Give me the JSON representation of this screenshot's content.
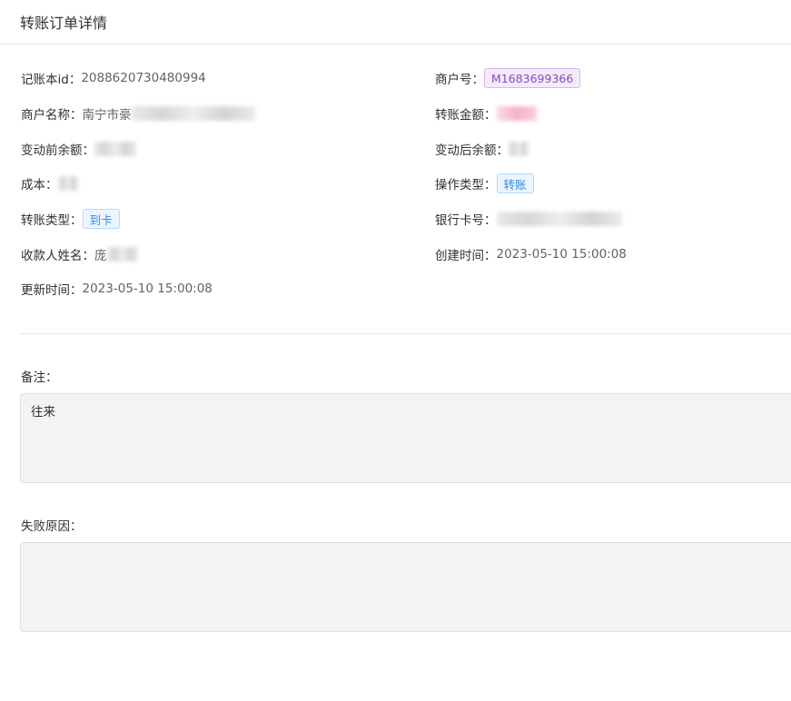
{
  "header": {
    "title": "转账订单详情"
  },
  "fields": {
    "ledger_id": {
      "label": "记账本id：",
      "value": "2088620730480994"
    },
    "merchant_no": {
      "label": "商户号：",
      "value": "M1683699366"
    },
    "merchant_name": {
      "label": "商户名称：",
      "value": "南宁市豪"
    },
    "transfer_amount": {
      "label": "转账金额："
    },
    "balance_before": {
      "label": "变动前余额："
    },
    "balance_after": {
      "label": "变动后余额："
    },
    "cost": {
      "label": "成本："
    },
    "operation_type": {
      "label": "操作类型：",
      "value": "转账"
    },
    "transfer_type": {
      "label": "转账类型：",
      "value": "到卡"
    },
    "bank_card_no": {
      "label": "银行卡号："
    },
    "payee_name": {
      "label": "收款人姓名：",
      "value": "庞"
    },
    "created_at": {
      "label": "创建时间：",
      "value": "2023-05-10 15:00:08"
    },
    "updated_at": {
      "label": "更新时间：",
      "value": "2023-05-10 15:00:08"
    }
  },
  "remark": {
    "label": "备注：",
    "value": "往来"
  },
  "failure_reason": {
    "label": "失败原因：",
    "value": ""
  },
  "colors": {
    "tag_purple": "#8e44c9",
    "tag_blue": "#2d8ce8",
    "divider": "#e8e8e8",
    "textbox_bg": "#f3f3f3"
  }
}
